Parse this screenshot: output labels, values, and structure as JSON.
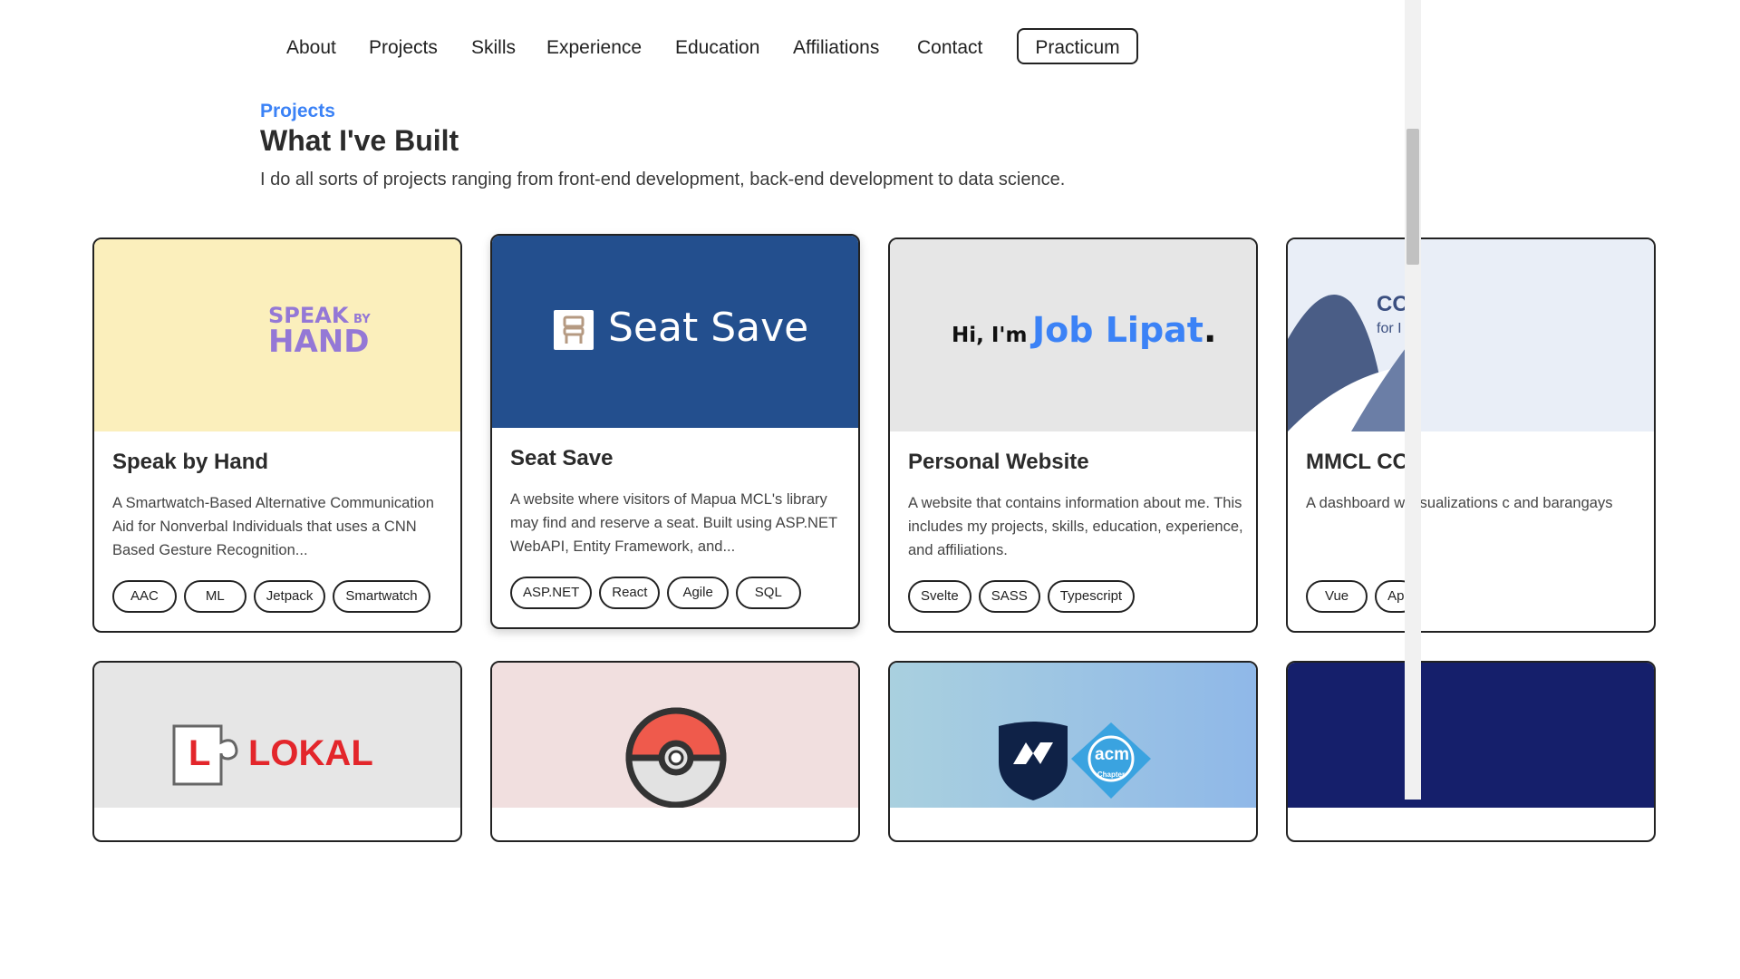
{
  "nav": {
    "items": [
      "About",
      "Projects",
      "Skills",
      "Experience",
      "Education",
      "Affiliations",
      "Contact"
    ],
    "cta": "Practicum"
  },
  "section": {
    "eyebrow": "Projects",
    "title": "What I've Built",
    "subtitle": "I do all sorts of projects ranging from front-end development, back-end development to data science."
  },
  "colors": {
    "accent": "#3b82f6",
    "seat_save_blue": "#234f8e",
    "speak_yellow": "#fbefbc",
    "speak_purple": "#9478d6"
  },
  "cards": [
    {
      "name": "Speak by Hand",
      "desc": "A Smartwatch-Based Alternative Communication Aid for Nonverbal Individuals that uses a CNN Based Gesture Recognition...",
      "tags": [
        "AAC",
        "ML",
        "Jetpack",
        "Smartwatch"
      ],
      "logo": {
        "line1": "SPEAK",
        "by": "BY",
        "line2": "HAND"
      }
    },
    {
      "name": "Seat Save",
      "desc": "A website where visitors of Mapua MCL's library may find and reserve a seat. Built using ASP.NET WebAPI, Entity Framework, and...",
      "tags": [
        "ASP.NET",
        "React",
        "Agile",
        "SQL"
      ],
      "logo": {
        "text": "Seat Save"
      }
    },
    {
      "name": "Personal Website",
      "desc": "A website that contains information about me. This includes my projects, skills, education, experience, and affiliations.",
      "tags": [
        "Svelte",
        "SASS",
        "Typescript"
      ],
      "logo": {
        "greeting": "Hi, I'm",
        "name": "Job Lipat",
        "dot": "."
      }
    },
    {
      "name": "MMCL CO",
      "desc": "A dashboard w visualizations c and barangays",
      "tags": [
        "Vue",
        "Ap"
      ],
      "logo": {
        "line1": "CO",
        "line2": "for I"
      }
    }
  ],
  "row2": {
    "lokal": {
      "letter": "L",
      "text": "LOKAL"
    },
    "acm": {
      "line1": "acm",
      "line2": "Chapter"
    }
  }
}
